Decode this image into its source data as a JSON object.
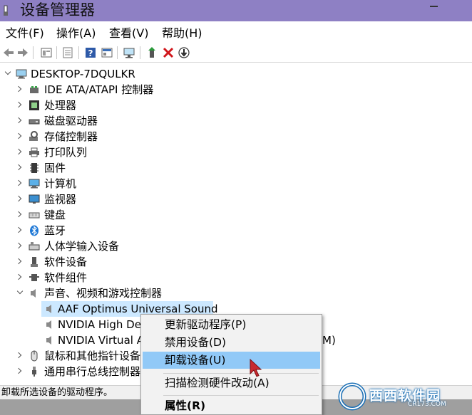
{
  "window": {
    "title": "设备管理器"
  },
  "menu": [
    "文件(F)",
    "操作(A)",
    "查看(V)",
    "帮助(H)"
  ],
  "toolbar": [
    "back-icon",
    "forward-icon",
    "properties-icon",
    "driver-icon",
    "help-icon",
    "view-icon",
    "scan-hardware-icon",
    "update-driver-icon",
    "uninstall-icon",
    "disable-icon"
  ],
  "tree": {
    "root": "DESKTOP-7DQULKR",
    "categories": [
      "IDE ATA/ATAPI 控制器",
      "处理器",
      "磁盘驱动器",
      "存储控制器",
      "打印队列",
      "固件",
      "计算机",
      "监视器",
      "键盘",
      "蓝牙",
      "人体学输入设备",
      "软件设备",
      "软件组件",
      "声音、视频和游戏控制器"
    ],
    "sound_devices": [
      "AAF Optimus Universal Sound",
      "NVIDIA High De",
      "NVIDIA Virtual A",
      "M)"
    ],
    "after_categories": [
      "鼠标和其他指针设备",
      "通用串行总线控制器"
    ]
  },
  "context_menu": {
    "items": [
      "更新驱动程序(P)",
      "禁用设备(D)",
      "卸载设备(U)",
      "扫描检测硬件改动(A)",
      "属性(R)"
    ],
    "highlighted": "卸载设备(U)"
  },
  "status": "卸载所选设备的驱动程序。",
  "watermark": {
    "text": "西西软件园",
    "sub": "CR173.COM"
  },
  "colors": {
    "titlebar": "#8e80c4",
    "selection": "#cce8ff",
    "menu_highlight": "#91c9f7"
  }
}
